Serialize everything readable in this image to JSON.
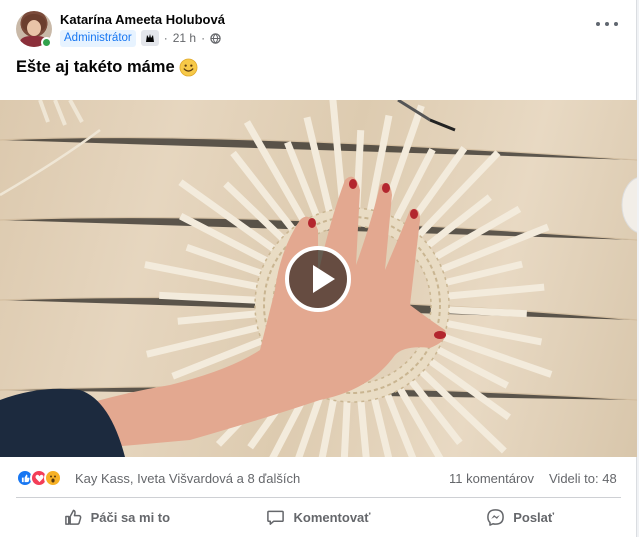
{
  "post": {
    "author": "Katarína Ameeta Holubová",
    "role": "Administrátor",
    "time": "21 h",
    "separator": "·",
    "text": "Ešte aj takéto máme",
    "more_icon": "more-horizontal-icon",
    "badge_icon": "community-badge-icon",
    "audience_icon": "globe-icon",
    "emoji_icon": "smile-emoji-icon"
  },
  "video": {
    "play_icon": "play-icon"
  },
  "stats": {
    "reactors": "Kay Kass, Iveta Višvardová a 8 ďalších",
    "comments": "11 komentárov",
    "views": "Videli to: 48",
    "reaction_icons": [
      "like-icon",
      "love-icon",
      "wow-icon"
    ]
  },
  "actions": {
    "like": "Páči sa mi to",
    "comment": "Komentovať",
    "share": "Poslať"
  },
  "colors": {
    "accent": "#1877f2",
    "online": "#31a24c",
    "secondary_text": "#65676b",
    "role_bg": "#e7f3ff"
  }
}
